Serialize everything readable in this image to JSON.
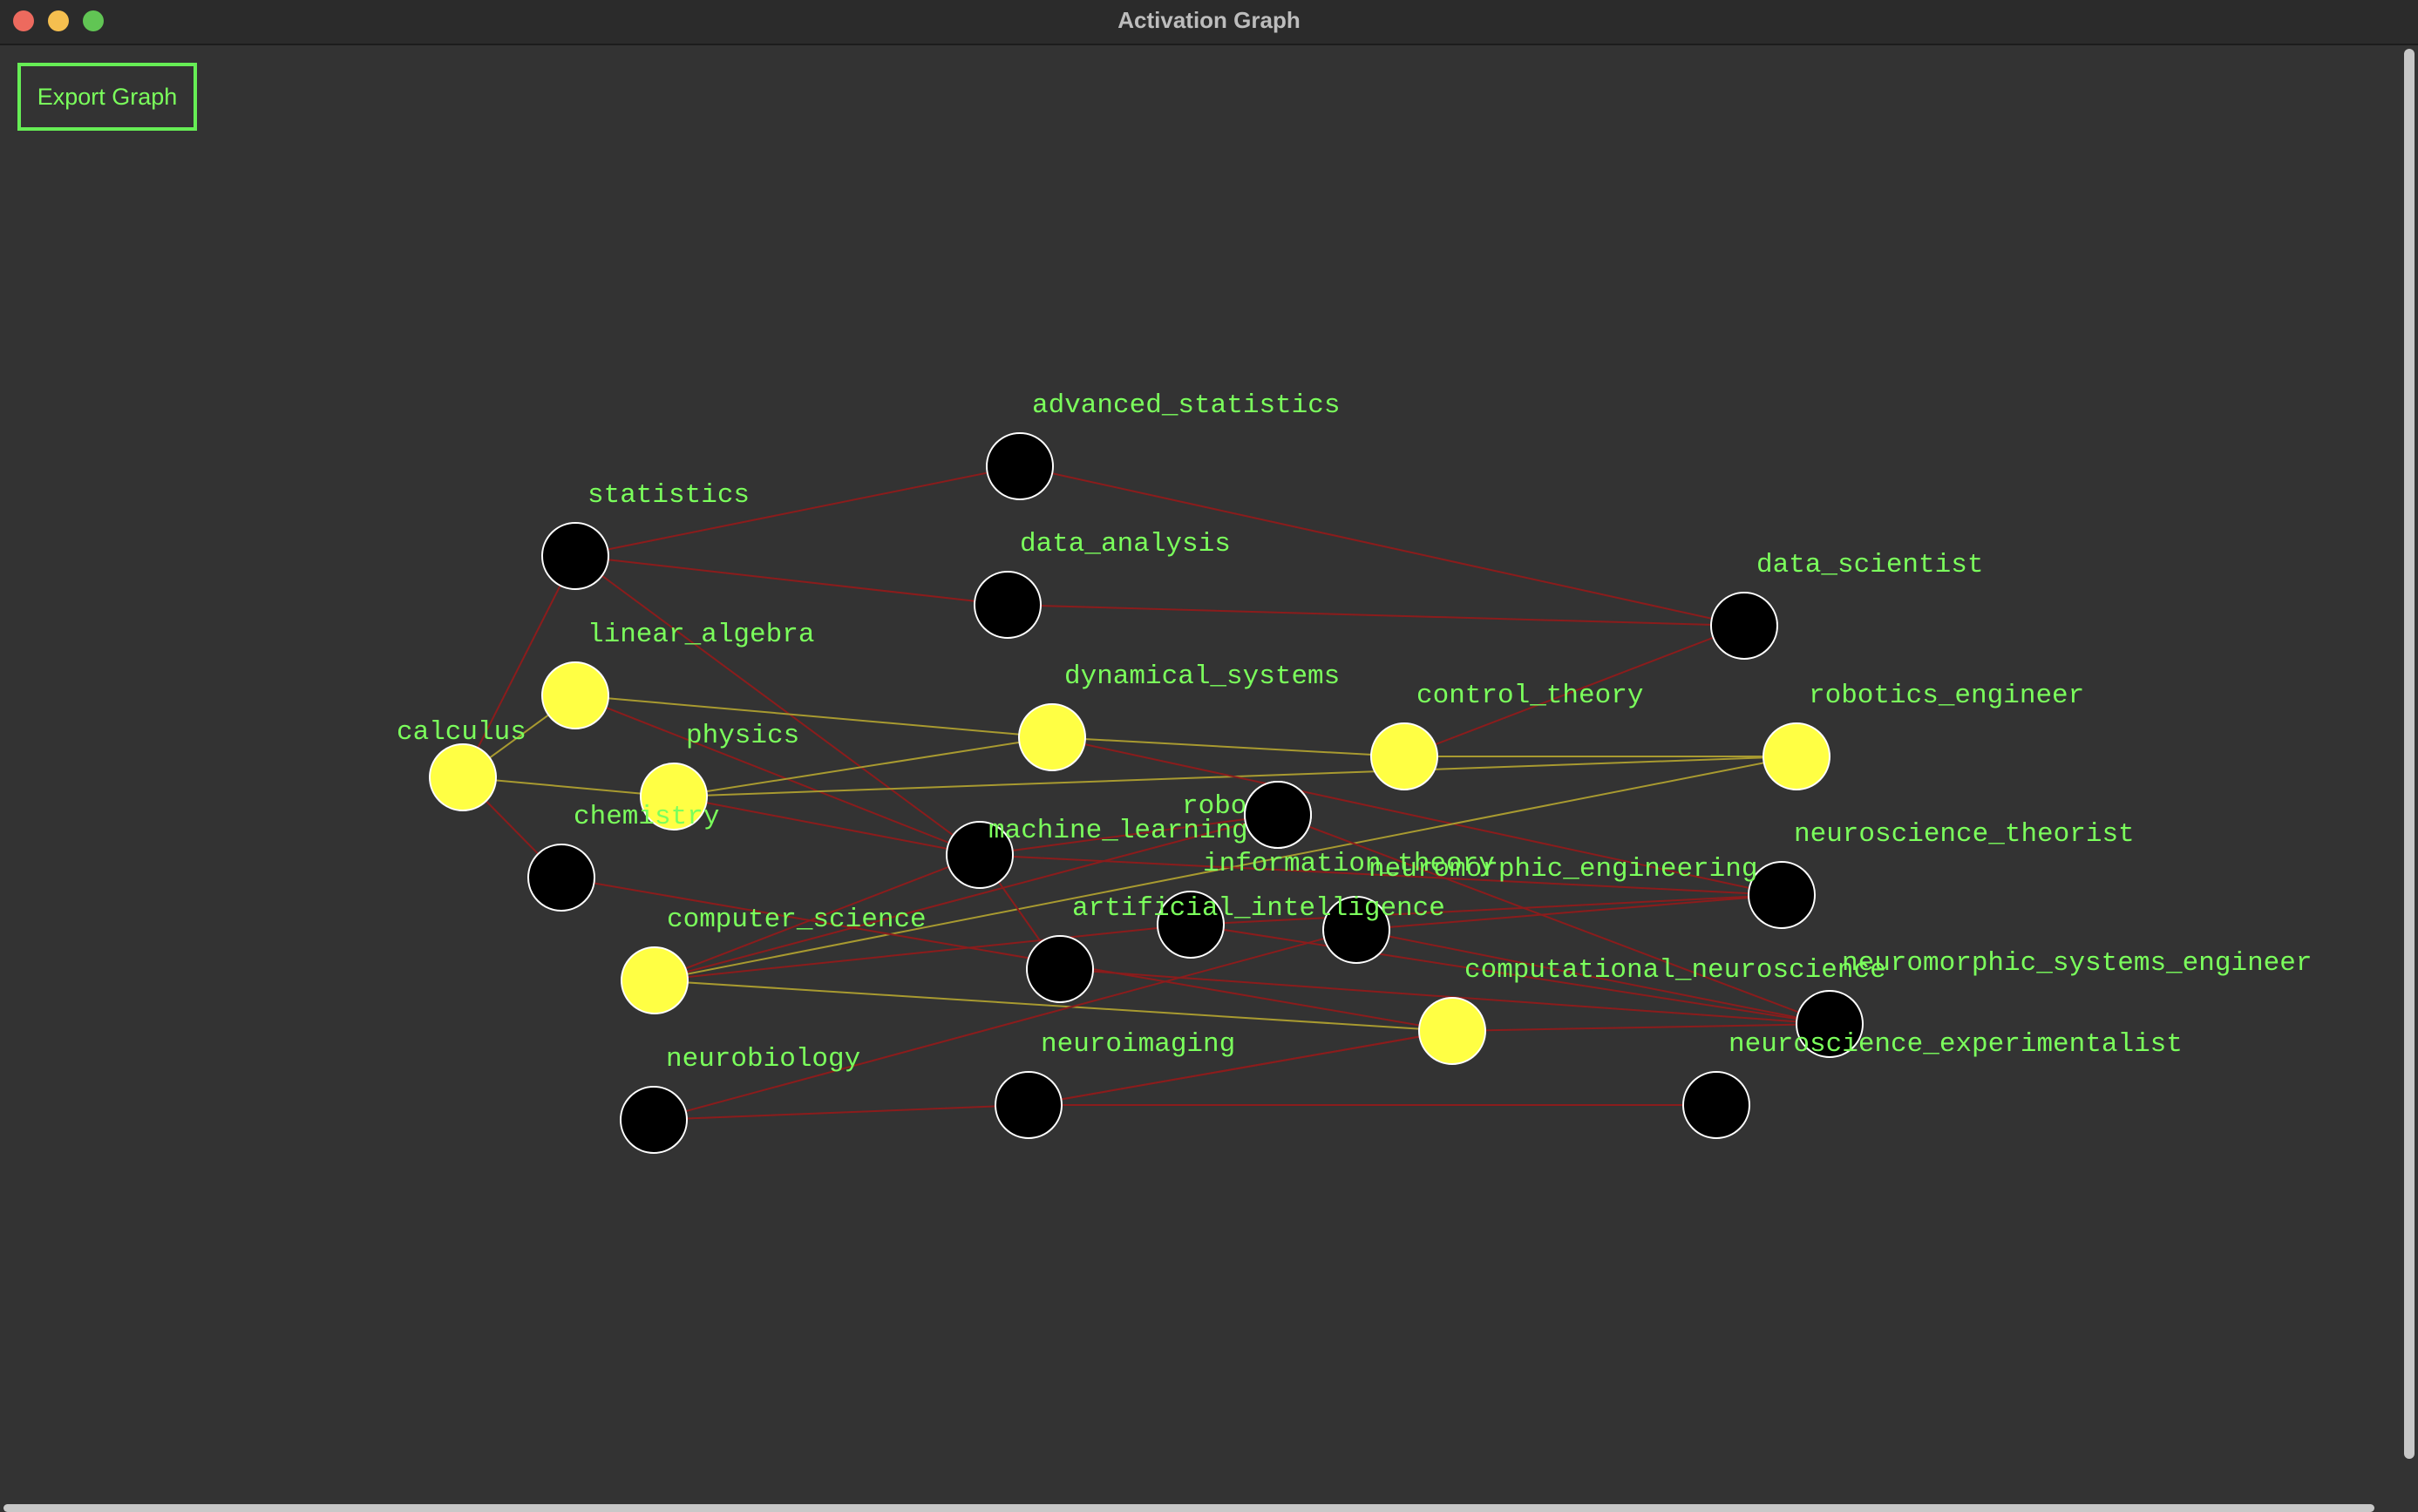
{
  "window": {
    "title": "Activation Graph"
  },
  "toolbar": {
    "export_label": "Export Graph"
  },
  "colors": {
    "active_node": "#ffff44",
    "inactive_node": "#000000",
    "node_outline": "#ffffff",
    "label": "#7bff5c",
    "edge_inactive": "#8b1c1c",
    "edge_active": "#a89a30"
  },
  "graph": {
    "nodes": [
      {
        "id": "advanced_statistics",
        "label": "advanced_statistics",
        "active": false
      },
      {
        "id": "statistics",
        "label": "statistics",
        "active": false
      },
      {
        "id": "data_analysis",
        "label": "data_analysis",
        "active": false
      },
      {
        "id": "data_scientist",
        "label": "data_scientist",
        "active": false
      },
      {
        "id": "linear_algebra",
        "label": "linear_algebra",
        "active": true
      },
      {
        "id": "dynamical_systems",
        "label": "dynamical_systems",
        "active": true
      },
      {
        "id": "control_theory",
        "label": "control_theory",
        "active": true
      },
      {
        "id": "robotics_engineer",
        "label": "robotics_engineer",
        "active": true
      },
      {
        "id": "calculus",
        "label": "calculus",
        "active": true
      },
      {
        "id": "physics",
        "label": "physics",
        "active": true
      },
      {
        "id": "robotics",
        "label": "robotics",
        "active": false
      },
      {
        "id": "machine_learning",
        "label": "machine_learning",
        "active": false
      },
      {
        "id": "chemistry",
        "label": "chemistry",
        "active": false
      },
      {
        "id": "neuroscience_theorist",
        "label": "neuroscience_theorist",
        "active": false
      },
      {
        "id": "information_theory",
        "label": "information_theory",
        "active": false
      },
      {
        "id": "neuromorphic_engineering",
        "label": "neuromorphic_engineering",
        "active": false
      },
      {
        "id": "artificial_intelligence",
        "label": "artificial_intelligence",
        "active": false
      },
      {
        "id": "computer_science",
        "label": "computer_science",
        "active": true
      },
      {
        "id": "computational_neuroscience",
        "label": "computational_neuroscience",
        "active": true
      },
      {
        "id": "neuromorphic_systems_engineer",
        "label": "neuromorphic_systems_engineer",
        "active": false
      },
      {
        "id": "neuroimaging",
        "label": "neuroimaging",
        "active": false
      },
      {
        "id": "neurobiology",
        "label": "neurobiology",
        "active": false
      },
      {
        "id": "neuroscience_experimentalist",
        "label": "neuroscience_experimentalist",
        "active": false
      },
      {
        "id": "extra_node",
        "label": "",
        "active": false
      }
    ],
    "edges": [
      {
        "from": "statistics",
        "to": "advanced_statistics",
        "active": false
      },
      {
        "from": "advanced_statistics",
        "to": "data_scientist",
        "active": false
      },
      {
        "from": "statistics",
        "to": "data_analysis",
        "active": false
      },
      {
        "from": "data_analysis",
        "to": "data_scientist",
        "active": false
      },
      {
        "from": "statistics",
        "to": "calculus",
        "active": false
      },
      {
        "from": "statistics",
        "to": "machine_learning",
        "active": false
      },
      {
        "from": "data_scientist",
        "to": "control_theory",
        "active": false
      },
      {
        "from": "calculus",
        "to": "linear_algebra",
        "active": true
      },
      {
        "from": "calculus",
        "to": "physics",
        "active": true
      },
      {
        "from": "calculus",
        "to": "chemistry",
        "active": false
      },
      {
        "from": "linear_algebra",
        "to": "dynamical_systems",
        "active": true
      },
      {
        "from": "linear_algebra",
        "to": "machine_learning",
        "active": false
      },
      {
        "from": "physics",
        "to": "dynamical_systems",
        "active": true
      },
      {
        "from": "physics",
        "to": "robotics_engineer",
        "active": true
      },
      {
        "from": "physics",
        "to": "machine_learning",
        "active": false
      },
      {
        "from": "dynamical_systems",
        "to": "control_theory",
        "active": true
      },
      {
        "from": "dynamical_systems",
        "to": "neuroscience_theorist",
        "active": false
      },
      {
        "from": "control_theory",
        "to": "robotics_engineer",
        "active": true
      },
      {
        "from": "robotics_engineer",
        "to": "computer_science",
        "active": true
      },
      {
        "from": "chemistry",
        "to": "computational_neuroscience",
        "active": false
      },
      {
        "from": "machine_learning",
        "to": "robotics",
        "active": false
      },
      {
        "from": "machine_learning",
        "to": "neuroscience_theorist",
        "active": false
      },
      {
        "from": "machine_learning",
        "to": "artificial_intelligence",
        "active": false
      },
      {
        "from": "computer_science",
        "to": "robotics",
        "active": false
      },
      {
        "from": "computer_science",
        "to": "machine_learning",
        "active": false
      },
      {
        "from": "computer_science",
        "to": "computational_neuroscience",
        "active": true
      },
      {
        "from": "computer_science",
        "to": "information_theory",
        "active": false
      },
      {
        "from": "computational_neuroscience",
        "to": "neuromorphic_systems_engineer",
        "active": false
      },
      {
        "from": "computational_neuroscience",
        "to": "neuroimaging",
        "active": false
      },
      {
        "from": "information_theory",
        "to": "neuromorphic_systems_engineer",
        "active": false
      },
      {
        "from": "information_theory",
        "to": "neuroscience_theorist",
        "active": false
      },
      {
        "from": "neuromorphic_engineering",
        "to": "neuroscience_theorist",
        "active": false
      },
      {
        "from": "neuromorphic_engineering",
        "to": "neuromorphic_systems_engineer",
        "active": false
      },
      {
        "from": "artificial_intelligence",
        "to": "neuromorphic_systems_engineer",
        "active": false
      },
      {
        "from": "robotics",
        "to": "neuromorphic_systems_engineer",
        "active": false
      },
      {
        "from": "neurobiology",
        "to": "neuroimaging",
        "active": false
      },
      {
        "from": "neurobiology",
        "to": "neuromorphic_engineering",
        "active": false
      },
      {
        "from": "neuroimaging",
        "to": "neuroscience_experimentalist",
        "active": false
      },
      {
        "from": "neuroimaging",
        "to": "computational_neuroscience",
        "active": false
      }
    ]
  }
}
